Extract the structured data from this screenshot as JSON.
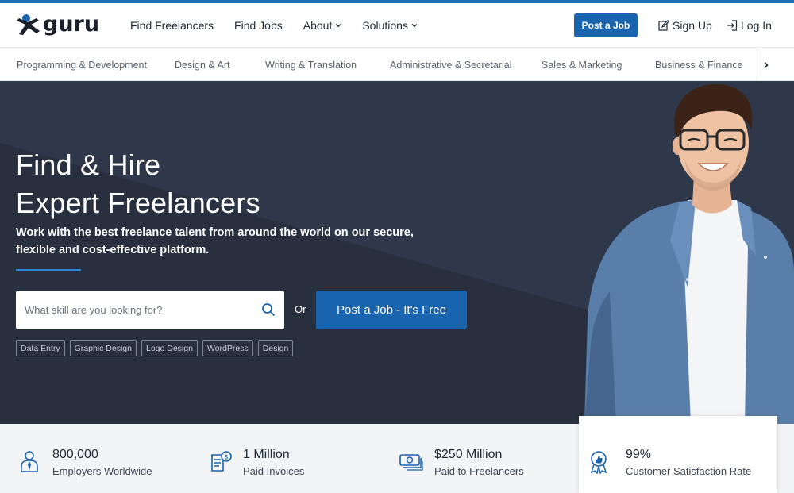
{
  "brand": {
    "logo_text": "guru",
    "accent": "#1a63ad"
  },
  "nav": {
    "items": [
      {
        "label": "Find Freelancers",
        "dropdown": false
      },
      {
        "label": "Find Jobs",
        "dropdown": false
      },
      {
        "label": "About",
        "dropdown": true
      },
      {
        "label": "Solutions",
        "dropdown": true
      }
    ],
    "post_job": "Post a Job",
    "sign_up": "Sign Up",
    "log_in": "Log In"
  },
  "categories": [
    "Programming & Development",
    "Design & Art",
    "Writing & Translation",
    "Administrative & Secretarial",
    "Sales & Marketing",
    "Business & Finance"
  ],
  "hero": {
    "title_line1": "Find & Hire",
    "title_line2": "Expert Freelancers",
    "subtitle_line1": "Work with the best freelance talent from around the world on our secure,",
    "subtitle_line2": "flexible and cost-effective platform.",
    "search_placeholder": "What skill are you looking for?",
    "or": "Or",
    "post_button": "Post a Job - It's Free",
    "tags": [
      "Data Entry",
      "Graphic Design",
      "Logo Design",
      "WordPress",
      "Design"
    ]
  },
  "stats": [
    {
      "value": "800,000",
      "label": "Employers Worldwide",
      "icon": "employer-icon"
    },
    {
      "value": "1 Million",
      "label": "Paid Invoices",
      "icon": "invoice-icon"
    },
    {
      "value": "$250 Million",
      "label": "Paid to Freelancers",
      "icon": "money-icon"
    },
    {
      "value": "99%",
      "label": "Customer Satisfaction Rate",
      "icon": "award-icon"
    }
  ]
}
